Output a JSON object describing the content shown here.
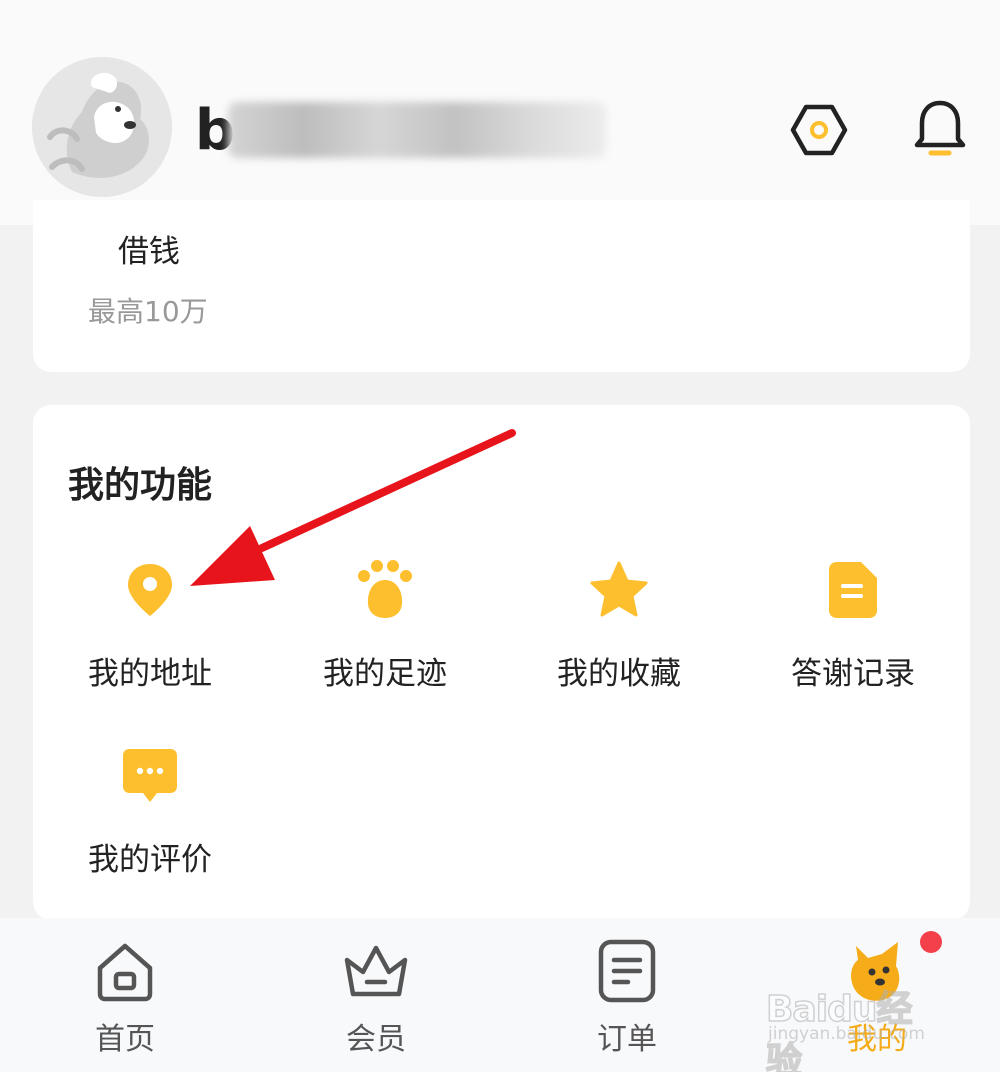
{
  "header": {
    "username_visible": "b"
  },
  "loan_card": {
    "title": "借钱",
    "subtitle": "最高10万"
  },
  "functions": {
    "title": "我的功能",
    "items": [
      {
        "label": "我的地址",
        "icon": "location-pin-icon"
      },
      {
        "label": "我的足迹",
        "icon": "paw-icon"
      },
      {
        "label": "我的收藏",
        "icon": "star-icon"
      },
      {
        "label": "答谢记录",
        "icon": "document-icon"
      },
      {
        "label": "我的评价",
        "icon": "comment-icon"
      }
    ]
  },
  "tabbar": {
    "tabs": [
      {
        "label": "首页",
        "icon": "home-icon"
      },
      {
        "label": "会员",
        "icon": "crown-icon"
      },
      {
        "label": "订单",
        "icon": "order-list-icon"
      },
      {
        "label": "我的",
        "icon": "dog-mascot-icon",
        "active": true
      }
    ]
  },
  "watermark": {
    "main": "Baidu经验",
    "sub": "jingyan.baidu.com"
  },
  "colors": {
    "accent": "#f5ac18",
    "icon_yellow": "#fdbf2d",
    "arrow": "#e8141b",
    "badge": "#f3404a"
  }
}
